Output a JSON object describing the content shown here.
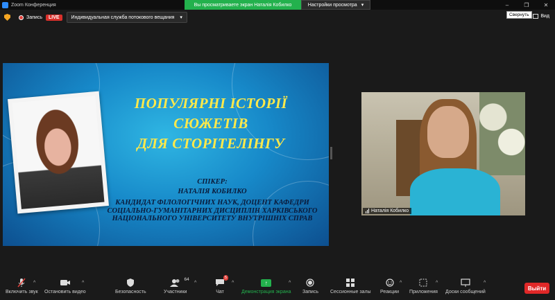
{
  "window": {
    "title": "Zoom Конференция",
    "minimize": "–",
    "restore": "❐",
    "close": "✕"
  },
  "banner": {
    "sharing_text": "Вы просматриваете экран Наталія Кобилко",
    "view_options": "Настройки просмотра"
  },
  "topbar": {
    "record_label": "Запись",
    "live_label": "LIVE",
    "stream_dropdown": "Индивидуальная служба потокового вещания",
    "collapse_tooltip": "Свернуть",
    "view_label": "Вид"
  },
  "slide": {
    "title_lines": [
      "ПОПУЛЯРНІ ІСТОРІЇ",
      "СЮЖЕТІВ",
      "ДЛЯ СТОРІТЕЛІНГУ"
    ],
    "speaker_label": "СПІКЕР:",
    "speaker_name": "НАТАЛІЯ КОБИЛКО",
    "speaker_desc": "КАНДИДАТ ФІЛОЛОГІЧНИХ НАУК, ДОЦЕНТ КАФЕДРИ СОЦІАЛЬНО-ГУМАНІТАРНИХ ДИСЦИПЛІН ХАРКІВСЬКОГО НАЦІОНАЛЬНОГО УНІВЕРСИТЕТУ ВНУТРІШНІХ СПРАВ"
  },
  "video": {
    "participant_name": "Наталія Кобилко"
  },
  "toolbar": {
    "mute": "Включить звук",
    "video": "Остановить видео",
    "security": "Безопасность",
    "participants": "Участники",
    "participants_count": "64",
    "chat": "Чат",
    "chat_badge": "5",
    "share": "Демонстрация экрана",
    "record": "Запись",
    "breakout": "Сессионные залы",
    "reactions": "Реакции",
    "apps": "Приложения",
    "whiteboards": "Доски сообщений",
    "leave": "Выйти"
  },
  "colors": {
    "share_green": "#23b14d",
    "live_red": "#d9302b",
    "leave_red": "#e02828",
    "slide_title_yellow": "#ffe94a"
  }
}
